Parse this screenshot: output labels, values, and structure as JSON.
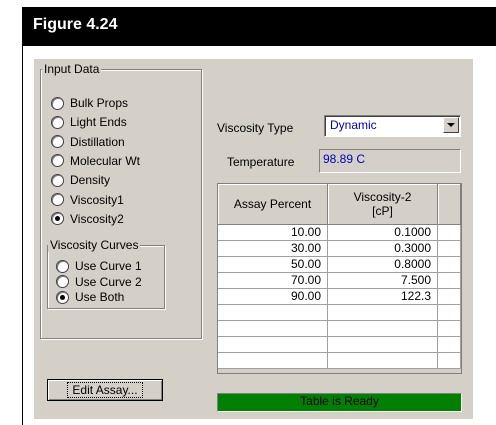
{
  "figure": {
    "title": "Figure 4.24"
  },
  "input_data": {
    "title": "Input Data",
    "options": [
      {
        "label": "Bulk Props",
        "checked": false
      },
      {
        "label": "Light Ends",
        "checked": false
      },
      {
        "label": "Distillation",
        "checked": false
      },
      {
        "label": "Molecular Wt",
        "checked": false
      },
      {
        "label": "Density",
        "checked": false
      },
      {
        "label": "Viscosity1",
        "checked": false
      },
      {
        "label": "Viscosity2",
        "checked": true
      }
    ]
  },
  "viscosity_curves": {
    "title": "Viscosity Curves",
    "options": [
      {
        "label": "Use Curve 1",
        "checked": false
      },
      {
        "label": "Use Curve 2",
        "checked": false
      },
      {
        "label": "Use Both",
        "checked": true
      }
    ]
  },
  "viscosity_type": {
    "label": "Viscosity Type",
    "value": "Dynamic"
  },
  "temperature": {
    "label": "Temperature",
    "value": "98.89 C"
  },
  "grid": {
    "headers": [
      "Assay Percent",
      "Viscosity-2",
      "[cP]"
    ],
    "rows": [
      [
        "10.00",
        "0.1000"
      ],
      [
        "30.00",
        "0.3000"
      ],
      [
        "50.00",
        "0.8000"
      ],
      [
        "70.00",
        "7.500"
      ],
      [
        "90.00",
        "122.3"
      ],
      [
        "",
        ""
      ],
      [
        "",
        ""
      ],
      [
        "",
        ""
      ],
      [
        "",
        ""
      ]
    ]
  },
  "edit_assay_label": "Edit Assay...",
  "status": {
    "text": "Table is Ready",
    "color": "#008000"
  }
}
